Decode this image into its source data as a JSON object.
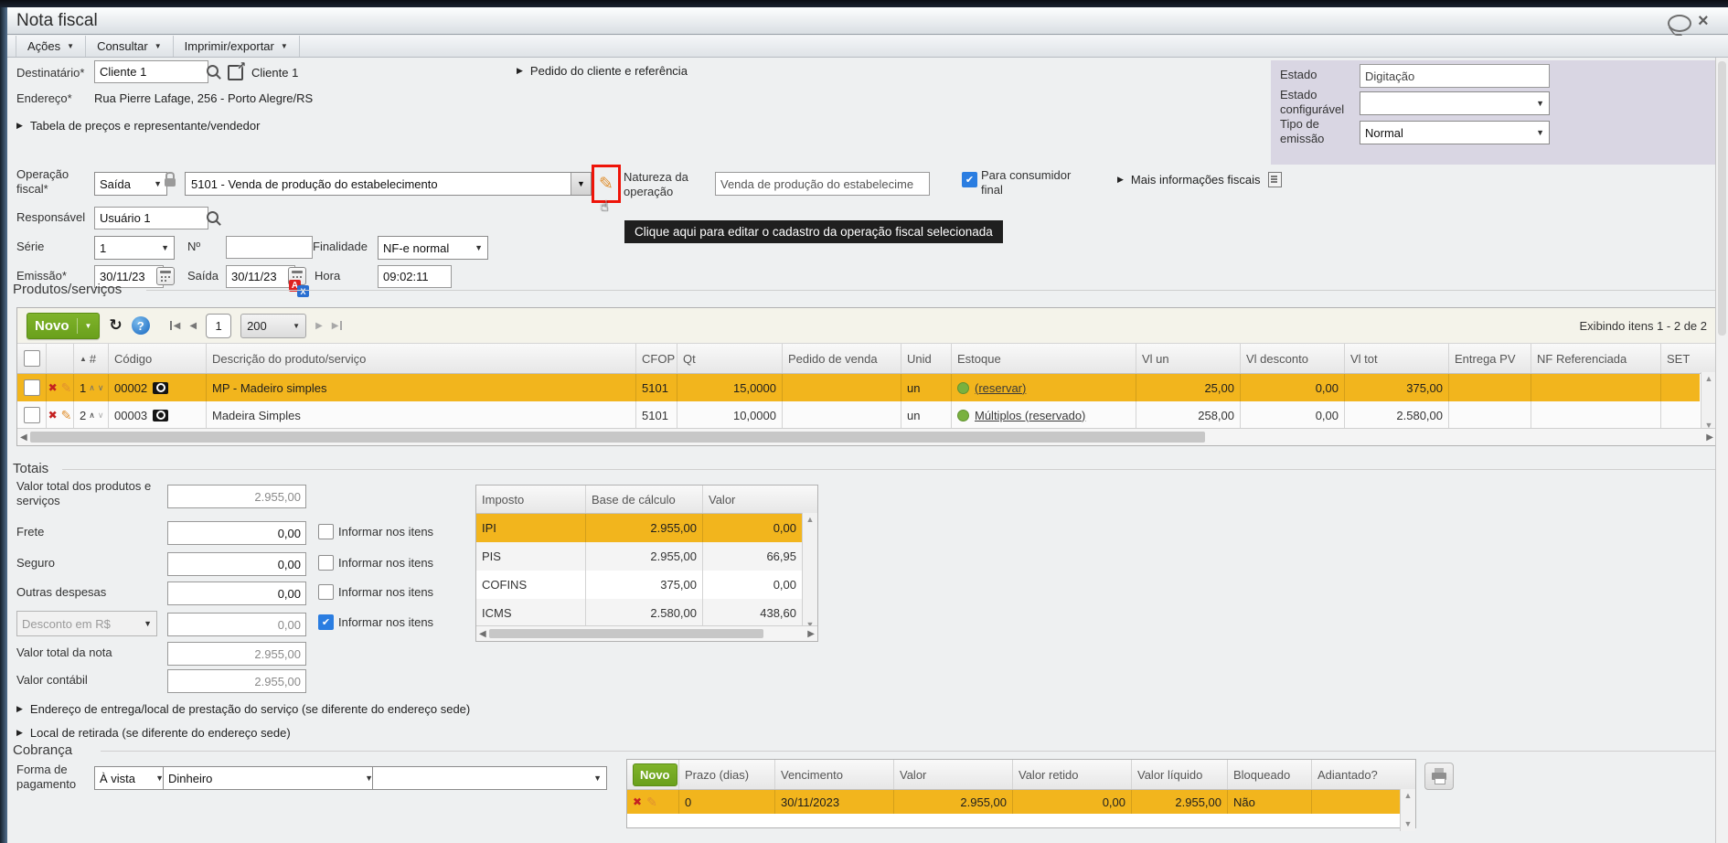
{
  "window": {
    "title": "Nota fiscal"
  },
  "menubar": {
    "items": [
      {
        "label": "Ações"
      },
      {
        "label": "Consultar"
      },
      {
        "label": "Imprimir/exportar"
      }
    ]
  },
  "form": {
    "destinatario_label": "Destinatário*",
    "destinatario_value": "Cliente 1",
    "destinatario_link": "Cliente 1",
    "pedido_cliente_toggle": "Pedido do cliente e referência",
    "endereco_label": "Endereço*",
    "endereco_value": "Rua Pierre Lafage, 256 - Porto Alegre/RS",
    "tabela_precos_toggle": "Tabela de preços e representante/vendedor",
    "estado_label": "Estado",
    "estado_value": "Digitação",
    "estado_config_label": "Estado configurável",
    "estado_config_value": "",
    "tipo_emissao_label": "Tipo de emissão",
    "tipo_emissao_value": "Normal",
    "operacao_label": "Operação fiscal*",
    "operacao_tipo": "Saída",
    "operacao_value": "5101 - Venda de produção do estabelecimento",
    "natureza_label": "Natureza da operação",
    "natureza_value": "Venda de produção do estabelecime",
    "consumidor_final_label": "Para consumidor final",
    "mais_info_toggle": "Mais informações fiscais",
    "tooltip": "Clique aqui para editar o cadastro da operação fiscal selecionada",
    "responsavel_label": "Responsável",
    "responsavel_value": "Usuário 1",
    "serie_label": "Série",
    "serie_value": "1",
    "numero_label": "Nº",
    "numero_value": "",
    "finalidade_label": "Finalidade",
    "finalidade_value": "NF-e normal",
    "emissao_label": "Emissão*",
    "emissao_value": "30/11/23",
    "saida_label": "Saída",
    "saida_value": "30/11/23",
    "hora_label": "Hora",
    "hora_value": "09:02:11"
  },
  "products": {
    "section_title": "Produtos/serviços",
    "toolbar": {
      "novo": "Novo",
      "page": "1",
      "page_size": "200",
      "exibindo": "Exibindo itens 1 - 2 de 2"
    },
    "columns": {
      "num": "#",
      "codigo": "Código",
      "descricao": "Descrição do produto/serviço",
      "cfop": "CFOP",
      "qt": "Qt",
      "pedido": "Pedido de venda",
      "unid": "Unid",
      "estoque": "Estoque",
      "vl_un": "Vl un",
      "vl_desconto": "Vl desconto",
      "vl_tot": "Vl tot",
      "entrega": "Entrega PV",
      "nf_ref": "NF Referenciada",
      "set": "SET"
    },
    "rows": [
      {
        "num": "1",
        "codigo": "00002",
        "descricao": "MP - Madeiro simples",
        "cfop": "5101",
        "qt": "15,0000",
        "pedido": "",
        "unid": "un",
        "estoque": "(reservar)",
        "vl_un": "25,00",
        "vl_desconto": "0,00",
        "vl_tot": "375,00",
        "entrega": "",
        "nf_ref": "",
        "set": ""
      },
      {
        "num": "2",
        "codigo": "00003",
        "descricao": "Madeira Simples",
        "cfop": "5101",
        "qt": "10,0000",
        "pedido": "",
        "unid": "un",
        "estoque": "Múltiplos (reservado)",
        "vl_un": "258,00",
        "vl_desconto": "0,00",
        "vl_tot": "2.580,00",
        "entrega": "",
        "nf_ref": "",
        "set": ""
      }
    ]
  },
  "totais": {
    "title": "Totais",
    "valor_total_produtos_label": "Valor total dos produtos e serviços",
    "valor_total_produtos": "2.955,00",
    "frete_label": "Frete",
    "frete": "0,00",
    "seguro_label": "Seguro",
    "seguro": "0,00",
    "outras_label": "Outras despesas",
    "outras": "0,00",
    "desconto_label": "Desconto em R$",
    "desconto": "0,00",
    "informar_label": "Informar nos itens",
    "valor_nota_label": "Valor total da nota",
    "valor_nota": "2.955,00",
    "valor_contabil_label": "Valor contábil",
    "valor_contabil": "2.955,00",
    "impostos": {
      "columns": {
        "imposto": "Imposto",
        "base": "Base de cálculo",
        "valor": "Valor"
      },
      "rows": [
        {
          "imposto": "IPI",
          "base": "2.955,00",
          "valor": "0,00"
        },
        {
          "imposto": "PIS",
          "base": "2.955,00",
          "valor": "66,95"
        },
        {
          "imposto": "COFINS",
          "base": "375,00",
          "valor": "0,00"
        },
        {
          "imposto": "ICMS",
          "base": "2.580,00",
          "valor": "438,60"
        }
      ]
    }
  },
  "sections": {
    "endereco_entrega": "Endereço de entrega/local de prestação do serviço (se diferente do endereço sede)",
    "local_retirada": "Local de retirada (se diferente do endereço sede)"
  },
  "cobranca": {
    "title": "Cobrança",
    "forma_label": "Forma de pagamento",
    "forma_tipo": "À vista",
    "forma_meio": "Dinheiro",
    "forma_extra": "",
    "novo": "Novo",
    "columns": {
      "prazo": "Prazo (dias)",
      "vencimento": "Vencimento",
      "valor": "Valor",
      "valor_retido": "Valor retido",
      "valor_liquido": "Valor líquido",
      "bloqueado": "Bloqueado",
      "adiantado": "Adiantado?"
    },
    "rows": [
      {
        "prazo": "0",
        "vencimento": "30/11/2023",
        "valor": "2.955,00",
        "valor_retido": "0,00",
        "valor_liquido": "2.955,00",
        "bloqueado": "Não",
        "adiantado": ""
      }
    ]
  },
  "colors": {
    "highlight": "#F2B51D",
    "accent_green": "#6AA01C",
    "panel_lavender": "#D9D6E3",
    "annotation_red": "#EE1409",
    "checkbox_blue": "#2A7DE1",
    "tooltip_bg": "#1F1F1F"
  }
}
